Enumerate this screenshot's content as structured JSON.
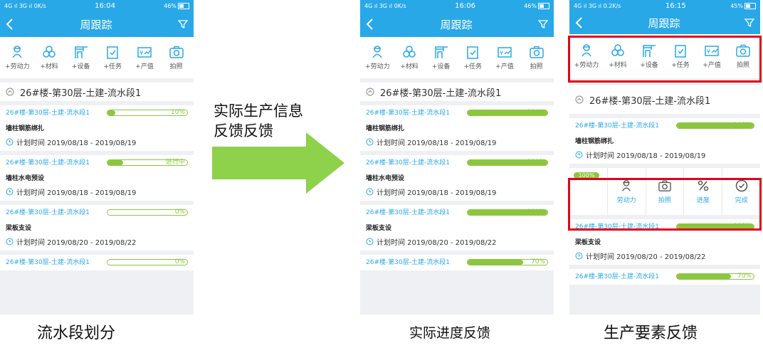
{
  "arrow_label": "实际生产信息反馈反馈",
  "colors": {
    "header_blue": "#29a8e8",
    "progress_green": "#8cc63f",
    "highlight_red": "#e3001b",
    "arrow_green": "#8ed14a"
  },
  "captions": {
    "left": "流水段划分",
    "middle": "实际进度反馈",
    "right": "生产要素反馈"
  },
  "phones": [
    {
      "status": {
        "left": "4G ıl 3G ıl 0K/s",
        "time": "16:04",
        "right": "46%"
      },
      "header": {
        "title": "周跟踪"
      },
      "toolbar": [
        "+劳动力",
        "+材料",
        "+设备",
        "+任务",
        "+产值",
        "拍照"
      ],
      "group": "26#楼-第30层-土建-流水段1",
      "tasks": [
        {
          "name": "26#楼-第30层-土建-流水段1",
          "progress_label": "10%",
          "progress": 10,
          "title": "墙柱钢筋绑扎",
          "time": "计划时间 2019/08/18 - 2019/08/19"
        },
        {
          "name": "26#楼-第30层-土建-流水段1",
          "progress_label": "进行中",
          "progress": 20,
          "title": "墙柱水电预设",
          "time": "计划时间 2019/08/18 - 2019/08/19"
        },
        {
          "name": "26#楼-第30层-土建-流水段1",
          "progress_label": "0%",
          "progress": 0,
          "title": "梁板支设",
          "time": "计划时间 2019/08/20 - 2019/08/22"
        },
        {
          "name": "26#楼-第30层-土建-流水段1",
          "progress_label": "0%",
          "progress": 0
        }
      ]
    },
    {
      "status": {
        "left": "4G ıl 3G ıl 0K/s",
        "time": "16:06",
        "right": "46%"
      },
      "header": {
        "title": "周跟踪"
      },
      "toolbar": [
        "+劳动力",
        "+材料",
        "+设备",
        "+任务",
        "+产值",
        "拍照"
      ],
      "group": "26#楼-第30层-土建-流水段1",
      "tasks": [
        {
          "name": "26#楼-第30层-土建-流水段1",
          "progress_label": "100%",
          "progress": 100,
          "title": "墙柱钢筋绑扎",
          "time": "计划时间 2019/08/18 - 2019/08/19"
        },
        {
          "name": "26#楼-第30层-土建-流水段1",
          "progress_label": "100%",
          "progress": 100,
          "title": "墙柱水电预设",
          "time": "计划时间 2019/08/18 - 2019/08/19"
        },
        {
          "name": "26#楼-第30层-土建-流水段1",
          "progress_label": "100%",
          "progress": 100,
          "title": "梁板支设",
          "time": "计划时间 2019/08/20 - 2019/08/22"
        },
        {
          "name": "26#楼-第30层-土建-流水段1",
          "progress_label": "70%",
          "progress": 70
        }
      ]
    },
    {
      "status": {
        "left": "4G ıl 3G ıl 0.2K/s",
        "time": "16:15",
        "right": "45%"
      },
      "header": {
        "title": "周跟踪"
      },
      "toolbar": [
        "+劳动力",
        "+材料",
        "+设备",
        "+任务",
        "+产值",
        "拍照"
      ],
      "group": "26#楼-第30层-土建-流水段1",
      "tasks": [
        {
          "name": "26#楼-第30层-土建-流水段1",
          "progress_label": "100%",
          "progress": 100,
          "title": "墙柱钢筋绑扎",
          "time": "计划时间 2019/08/18 - 2019/08/19"
        },
        {
          "name": "26#楼-第30层-土建-流水段1",
          "progress_label": "100%",
          "progress": 100,
          "title": "梁板支设",
          "time": "计划时间 2019/08/20 - 2019/08/22"
        },
        {
          "name": "26#楼-第30层-土建-流水段1",
          "progress_label": "70%",
          "progress": 70
        }
      ],
      "actions": {
        "mini_progress": "100%",
        "items": [
          "劳动力",
          "拍照",
          "进度",
          "完成"
        ]
      }
    }
  ]
}
